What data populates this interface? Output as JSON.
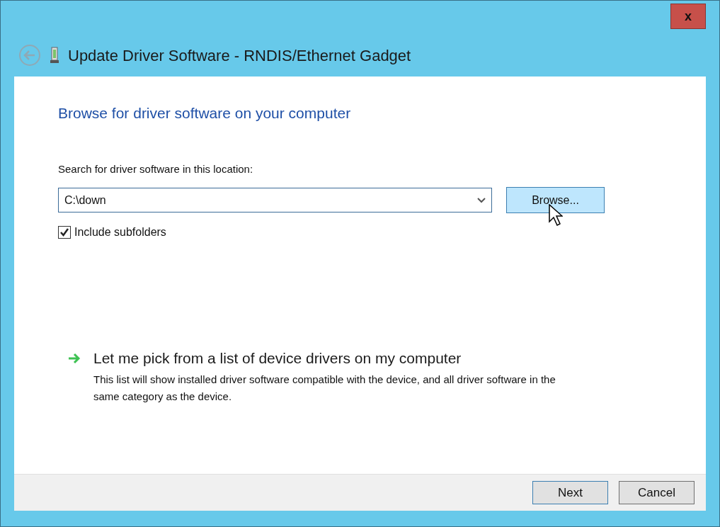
{
  "window": {
    "title": "Update Driver Software - RNDIS/Ethernet Gadget",
    "close_label": "x"
  },
  "heading": "Browse for driver software on your computer",
  "location": {
    "label": "Search for driver software in this location:",
    "value": "C:\\down",
    "browse": {
      "label": "Browse...",
      "hovered": true
    }
  },
  "include_subfolders": {
    "label": "Include subfolders",
    "checked": true
  },
  "option": {
    "title": "Let me pick from a list of device drivers on my computer",
    "description": "This list will show installed driver software compatible with the device, and all driver software in the same category as the device."
  },
  "buttons": [
    {
      "label": "Next",
      "default": true
    },
    {
      "label": "Cancel",
      "default": false
    }
  ]
}
